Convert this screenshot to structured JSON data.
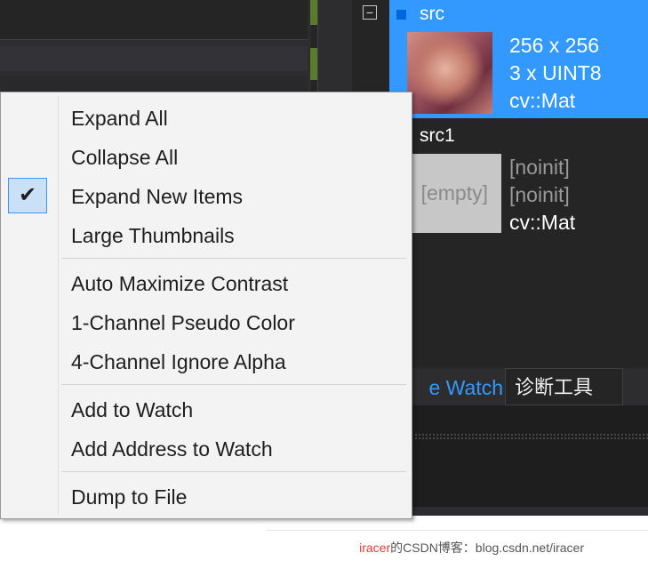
{
  "watch": {
    "collapse_symbol": "−",
    "items": [
      {
        "name": "src",
        "width_height": "256 x 256",
        "channels_type": "3 x UINT8",
        "type": "cv::Mat"
      },
      {
        "name": "src1",
        "thumbnail_text": "[empty]",
        "width_height": "[noinit]",
        "channels_type": "[noinit]",
        "type": "cv::Mat"
      }
    ],
    "tabs": {
      "watch": "e Watch",
      "diagnostic": "诊断工具"
    }
  },
  "context_menu": {
    "check_symbol": "✔",
    "items": [
      {
        "label": "Expand All",
        "checked": false
      },
      {
        "label": "Collapse All",
        "checked": false
      },
      {
        "label": "Expand New Items",
        "checked": true
      },
      {
        "label": "Large Thumbnails",
        "checked": false
      },
      {
        "label": "Auto Maximize Contrast",
        "checked": false
      },
      {
        "label": "1-Channel Pseudo Color",
        "checked": false
      },
      {
        "label": "4-Channel Ignore Alpha",
        "checked": false
      },
      {
        "label": "Add to Watch",
        "checked": false
      },
      {
        "label": "Add Address to Watch",
        "checked": false
      },
      {
        "label": "Dump to File",
        "checked": false
      }
    ]
  },
  "footer": {
    "name": "iracer",
    "rest": "的CSDN博客：blog.csdn.net/iracer"
  },
  "colors": {
    "selection": "#3399ff",
    "menu_bg": "#f3f3f3",
    "ide_bg": "#252526"
  }
}
